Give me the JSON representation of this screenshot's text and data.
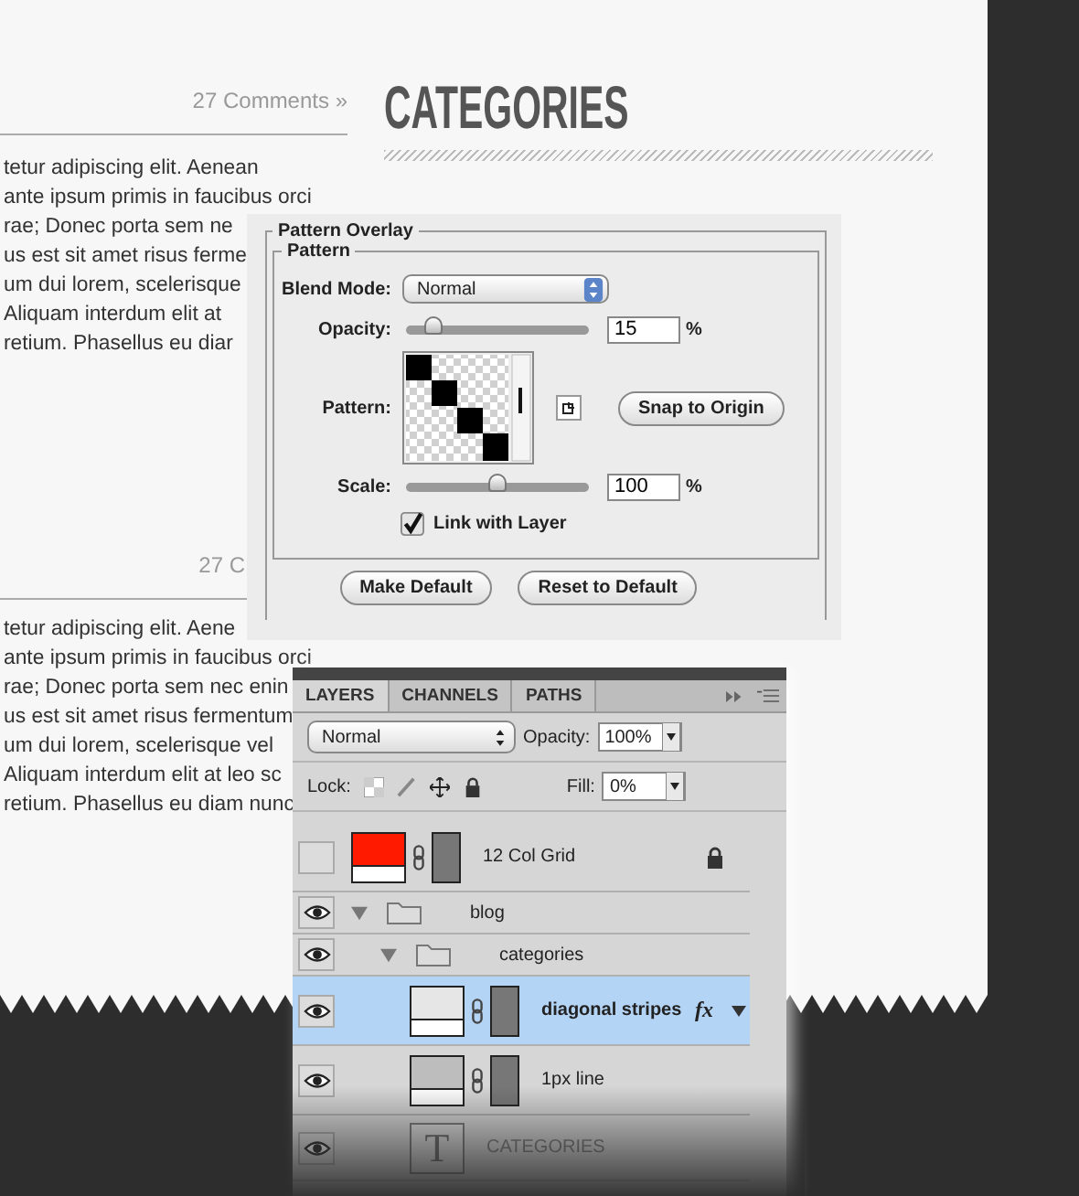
{
  "page": {
    "posts": [
      {
        "meta": "27 Comments »",
        "lines": [
          "tetur adipiscing elit. Aenean",
          "ante ipsum primis in faucibus orci",
          "rae; Donec porta sem ne",
          "us est sit amet risus ferme",
          "um dui lorem, scelerisque",
          "Aliquam interdum elit at",
          "retium. Phasellus eu diar"
        ]
      },
      {
        "meta": "27 C",
        "lines": [
          "tetur adipiscing elit. Aene",
          "ante ipsum primis in faucibus orci",
          "rae; Donec porta sem nec enin",
          "us est sit amet risus fermentum",
          "um dui lorem, scelerisque vel",
          "Aliquam interdum elit at leo sc",
          "retium. Phasellus eu diam nunc"
        ]
      }
    ],
    "sidebar_heading": "CATEGORIES"
  },
  "pattern_overlay": {
    "title": "Pattern Overlay",
    "group_title": "Pattern",
    "blend_mode": {
      "label": "Blend Mode:",
      "value": "Normal"
    },
    "opacity": {
      "label": "Opacity:",
      "level": 0.15,
      "value": "15",
      "unit": "%"
    },
    "pattern": {
      "label": "Pattern:"
    },
    "snap_button": "Snap to Origin",
    "scale": {
      "label": "Scale:",
      "level": 0.5,
      "value": "100",
      "unit": "%"
    },
    "link_with_layer": {
      "label": "Link with Layer",
      "checked": true
    },
    "buttons": [
      "Make Default",
      "Reset to Default"
    ]
  },
  "layers_panel": {
    "tabs": [
      {
        "label": "LAYERS",
        "selected": true
      },
      {
        "label": "CHANNELS",
        "selected": false
      },
      {
        "label": "PATHS",
        "selected": false
      }
    ],
    "blend_mode": "Normal",
    "opacity": {
      "label": "Opacity:",
      "value": "100%"
    },
    "lock_label": "Lock:",
    "fill": {
      "label": "Fill:",
      "value": "0%"
    },
    "layers": [
      {
        "kind": "layer",
        "name": "12 Col Grid",
        "visible": false,
        "selected": false,
        "locked": true,
        "color": "#ff1a00"
      },
      {
        "kind": "group",
        "name": "blog",
        "visible": true,
        "selected": false,
        "expanded": true,
        "children": [
          {
            "kind": "group",
            "name": "categories",
            "visible": true,
            "selected": false,
            "expanded": true,
            "children": [
              {
                "kind": "layer",
                "name": "diagonal stripes",
                "visible": true,
                "selected": true,
                "locked": false,
                "color": "#e6e6e6",
                "effects": "fx"
              },
              {
                "kind": "layer",
                "name": "1px line",
                "visible": true,
                "selected": false,
                "locked": false,
                "color": "#bdbdbd"
              },
              {
                "kind": "text",
                "name": "CATEGORIES",
                "thumb_text": "T",
                "visible": true,
                "selected": false
              }
            ]
          }
        ]
      }
    ]
  }
}
